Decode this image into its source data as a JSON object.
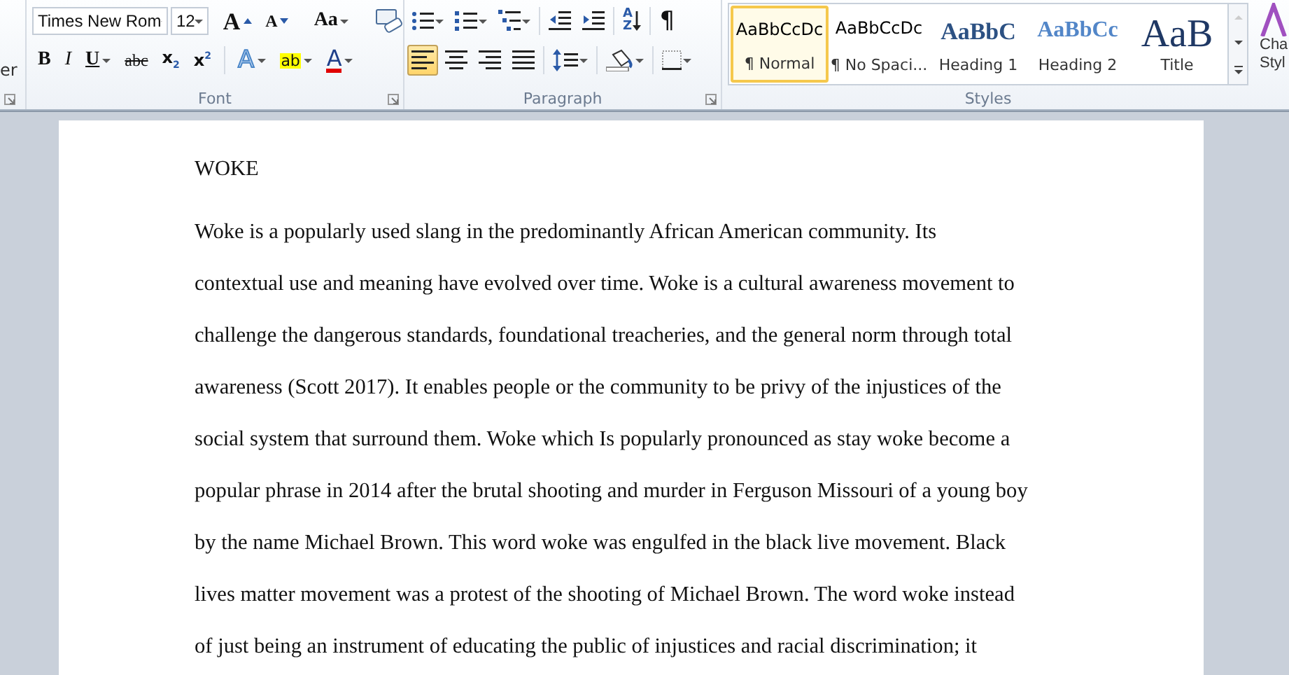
{
  "ribbon": {
    "cut_group": {
      "label_fragment": "er"
    },
    "font_group": {
      "label": "Font",
      "font_name": "Times New Rom",
      "font_size": "12",
      "row1_tools": [
        {
          "kind": "grow",
          "glyph": "A"
        },
        {
          "kind": "shrink",
          "glyph": "A"
        },
        {
          "kind": "case",
          "glyph": "Aa",
          "dropdown": true
        },
        {
          "kind": "clear"
        }
      ],
      "row2_tools": [
        {
          "kind": "bold",
          "glyph": "B"
        },
        {
          "kind": "italic",
          "glyph": "I"
        },
        {
          "kind": "underline",
          "glyph": "U",
          "dropdown": true
        },
        {
          "kind": "strike",
          "glyph": "abc"
        },
        {
          "kind": "subscript",
          "glyph": "x$_{2}$"
        },
        {
          "kind": "superscript",
          "glyph": "x$^{2}$"
        },
        {
          "kind": "effects",
          "glyph": "A",
          "dropdown": true
        },
        {
          "kind": "highlight",
          "glyph": "ab",
          "dropdown": true
        },
        {
          "kind": "color",
          "glyph": "A",
          "dropdown": true
        }
      ]
    },
    "paragraph_group": {
      "label": "Paragraph",
      "row1_tools": [
        {
          "kind": "bullets",
          "dropdown": true
        },
        {
          "kind": "numbering",
          "dropdown": true
        },
        {
          "kind": "multilevel",
          "dropdown": true
        },
        {
          "kind": "outdent"
        },
        {
          "kind": "indent"
        },
        {
          "kind": "sort",
          "glyph": "AZ"
        },
        {
          "kind": "pilcrow",
          "glyph": "¶"
        }
      ],
      "alignments": [
        {
          "kind": "left",
          "selected": true
        },
        {
          "kind": "center",
          "selected": false
        },
        {
          "kind": "right",
          "selected": false
        },
        {
          "kind": "justify",
          "selected": false
        }
      ],
      "row2_tools": [
        {
          "kind": "spacing",
          "dropdown": true
        },
        {
          "kind": "shading",
          "dropdown": true
        },
        {
          "kind": "borders",
          "dropdown": true
        }
      ]
    },
    "styles_group": {
      "label": "Styles",
      "gallery": [
        {
          "kind": "normal",
          "preview": "AaBbCcDc",
          "label": "¶ Normal",
          "selected": true
        },
        {
          "kind": "normal",
          "preview": "AaBbCcDc",
          "label": "¶ No Spaci...",
          "selected": false
        },
        {
          "kind": "heading1",
          "preview": "AaBbC",
          "label": "Heading 1",
          "selected": false
        },
        {
          "kind": "heading2",
          "preview": "AaBbCc",
          "label": "Heading 2",
          "selected": false
        },
        {
          "kind": "title",
          "preview": "AaB",
          "label": "Title",
          "selected": false
        }
      ]
    },
    "change_styles": {
      "label_line1": "Cha",
      "label_line2": "Styl"
    }
  },
  "document": {
    "title": "WOKE",
    "lines": [
      "Woke is a popularly used slang in the predominantly African American community. Its",
      "contextual use and meaning have evolved over time. Woke is a cultural awareness movement to",
      "challenge the dangerous standards, foundational treacheries, and the general norm through total",
      "awareness (Scott 2017). It enables people or the community to be privy of the injustices of the",
      "social system that surround them. Woke which Is popularly pronounced as stay woke become a",
      "popular phrase in 2014 after the brutal shooting and murder in Ferguson Missouri  of a young boy",
      "by the name Michael  Brown. This  word woke was engulfed in the black live movement. Black",
      "lives matter movement was a protest of the shooting of Michael Brown. The word woke instead",
      "of just being an instrument of educating the public of injustices and racial discrimination; it"
    ]
  }
}
